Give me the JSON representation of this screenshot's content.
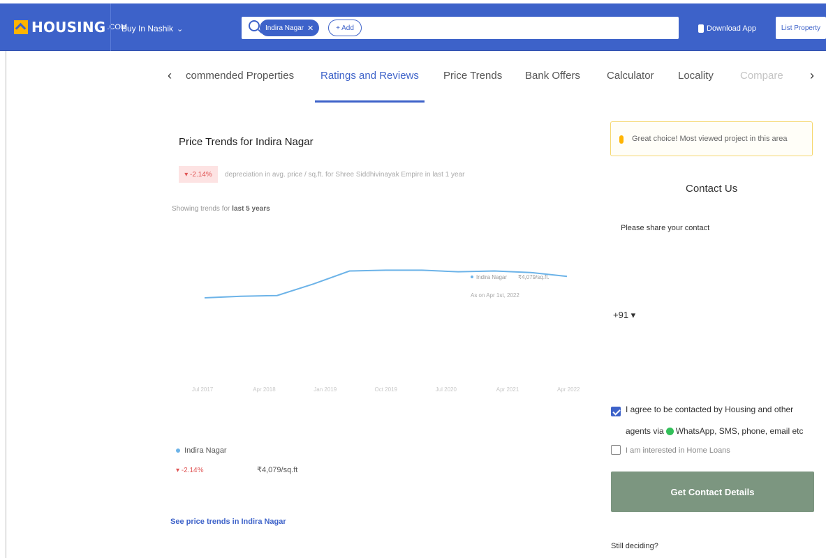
{
  "header": {
    "logo_text": "HOUSING",
    "logo_suffix": ".COM",
    "city_selector": "Buy In Nashik",
    "search_chip": "Indira Nagar",
    "add_label": "+ Add",
    "download_app": "Download App",
    "list_property": "List Property"
  },
  "tabs": {
    "items": [
      "commended Properties",
      "Ratings and Reviews",
      "Price Trends",
      "Bank Offers",
      "Calculator",
      "Locality",
      "Compare"
    ],
    "active": "Ratings and Reviews"
  },
  "price_trends": {
    "title": "Price Trends for Indira Nagar",
    "badge": "▾ -2.14%",
    "depreciation_text": "depreciation in avg. price / sq.ft. for Shree Siddhivinayak Empire in last 1 year",
    "showing_prefix": "Showing trends for",
    "showing_period": "last 5 years",
    "see_link": "See price trends in Indira Nagar"
  },
  "chart_data": {
    "type": "line",
    "x": [
      "Jul 2017",
      "Apr 2018",
      "Jan 2019",
      "Oct 2019",
      "Jul 2020",
      "Apr 2021",
      "Apr 2022"
    ],
    "series": [
      {
        "name": "Indira Nagar",
        "values": [
          3800,
          3820,
          3830,
          3980,
          4150,
          4160,
          4160,
          4140,
          4150,
          4130,
          4079
        ],
        "color": "#6cb3e8"
      }
    ],
    "tooltip": {
      "label": "Indira Nagar",
      "value": "₹4,079/sq.ft.",
      "date": "As on Apr 1st, 2022"
    }
  },
  "legend": {
    "name": "Indira Nagar",
    "change": "▾ -2.14%",
    "price": "₹4,079/sq.ft"
  },
  "contact": {
    "notice": "Great choice! Most viewed project in this area",
    "title": "Contact Us",
    "share": "Please share your contact",
    "country_code": "+91 ▾",
    "agree_line1": "I agree to be contacted by Housing and other",
    "agree_line2_prefix": "agents via",
    "agree_line2_suffix": "WhatsApp, SMS, phone, email etc",
    "home_loans": "I am interested in Home Loans",
    "cta": "Get Contact Details",
    "still_deciding": "Still deciding?"
  },
  "colors": {
    "brand": "#3d62c9",
    "line": "#6cb3e8",
    "negative": "#e05555",
    "cta": "#7c9680"
  }
}
